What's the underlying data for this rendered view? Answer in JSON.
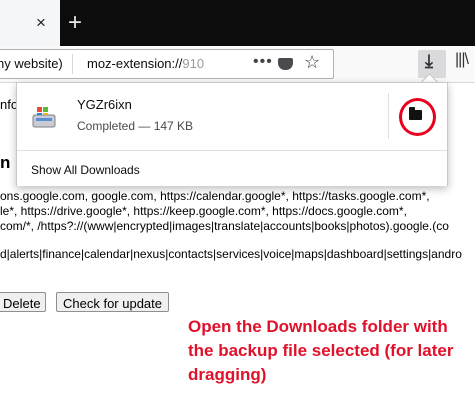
{
  "browser": {
    "tab_close_glyph": "×",
    "new_tab_glyph": "+",
    "identity_text": "ny website)",
    "url_visible": "moz-extension://",
    "url_dim": "910",
    "page_actions_glyph": "•••",
    "star_glyph": "☆",
    "download_glyph": "⤓",
    "library_glyph": "|||\\"
  },
  "page": {
    "info_fragment": "nfo",
    "heading_fragment": "n D",
    "domains_line1": "ons.google.com, google.com, https://calendar.google*, https://tasks.google.com*,",
    "domains_line2": "le*, https://drive.google*, https://keep.google.com*, https://docs.google.com*,",
    "domains_line3": "com/*, /https?://(www|encrypted|images|translate|accounts|books|photos).google.(co",
    "filters_line": "d|alerts|finance|calendar|nexus|contacts|services|voice|maps|dashboard|settings|andro",
    "delete_label": "Delete",
    "update_label": "Check for update"
  },
  "downloads_panel": {
    "file_name": "YGZr6ixn",
    "file_status": "Completed — 147 KB",
    "show_all_label": "Show All Downloads"
  },
  "annotation": {
    "text": "Open the Downloads folder with the backup file selected (for later dragging)",
    "color": "#e0112b"
  },
  "colors": {
    "tabbar": "#0c0c0d",
    "highlight_circle": "#e8001f"
  }
}
